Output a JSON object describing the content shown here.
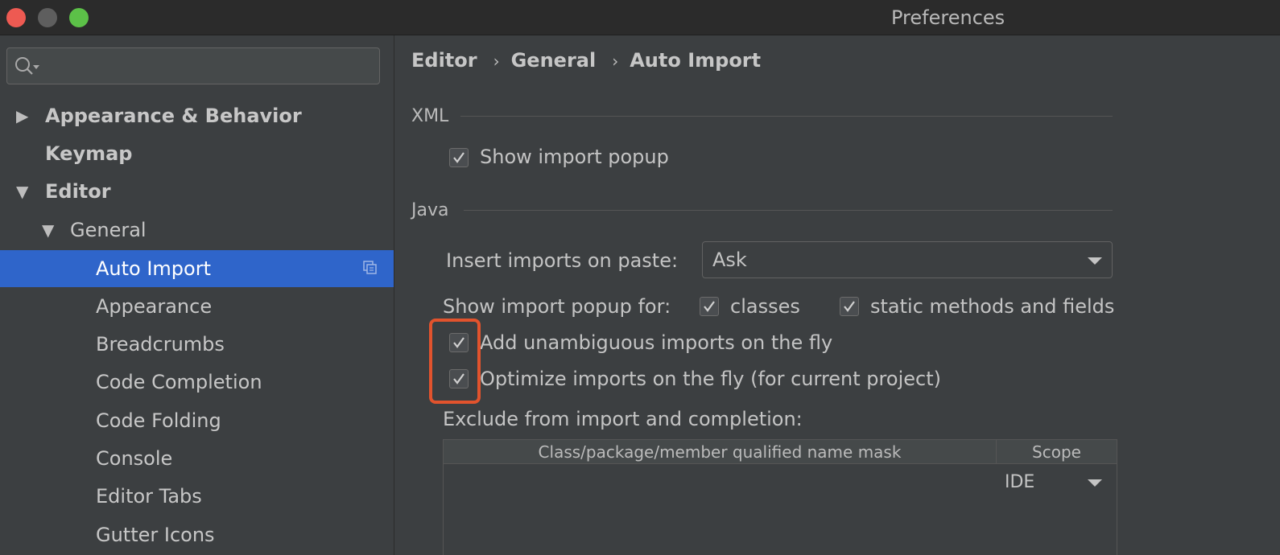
{
  "window": {
    "title": "Preferences"
  },
  "search": {
    "placeholder": ""
  },
  "tree": [
    {
      "label": "Appearance & Behavior",
      "expander": "▶"
    },
    {
      "label": "Keymap",
      "expander": ""
    },
    {
      "label": "Editor",
      "expander": "▼"
    },
    {
      "label": "General",
      "expander": "▼"
    },
    {
      "label": "Auto Import",
      "expander": ""
    },
    {
      "label": "Appearance",
      "expander": ""
    },
    {
      "label": "Breadcrumbs",
      "expander": ""
    },
    {
      "label": "Code Completion",
      "expander": ""
    },
    {
      "label": "Code Folding",
      "expander": ""
    },
    {
      "label": "Console",
      "expander": ""
    },
    {
      "label": "Editor Tabs",
      "expander": ""
    },
    {
      "label": "Gutter Icons",
      "expander": ""
    }
  ],
  "breadcrumb": {
    "items": [
      "Editor",
      "General",
      "Auto Import"
    ],
    "separator": "›"
  },
  "xml": {
    "title": "XML",
    "show_import_popup": {
      "label": "Show import popup",
      "checked": true
    }
  },
  "java": {
    "title": "Java",
    "insert_imports": {
      "label": "Insert imports on paste:",
      "value": "Ask"
    },
    "show_popup_for": {
      "label": "Show import popup for:",
      "classes": {
        "label": "classes",
        "checked": true
      },
      "static": {
        "label": "static methods and fields",
        "checked": true
      }
    },
    "add_unambiguous": {
      "label": "Add unambiguous imports on the fly",
      "checked": true
    },
    "optimize_imports": {
      "label": "Optimize imports on the fly (for current project)",
      "checked": true
    },
    "exclude": {
      "label": "Exclude from import and completion:",
      "columns": [
        "Class/package/member qualified name mask",
        "Scope"
      ],
      "row_scope": "IDE"
    }
  },
  "colors": {
    "selection": "#2f65ca",
    "highlight": "#e2532d",
    "background": "#3c3f41"
  }
}
